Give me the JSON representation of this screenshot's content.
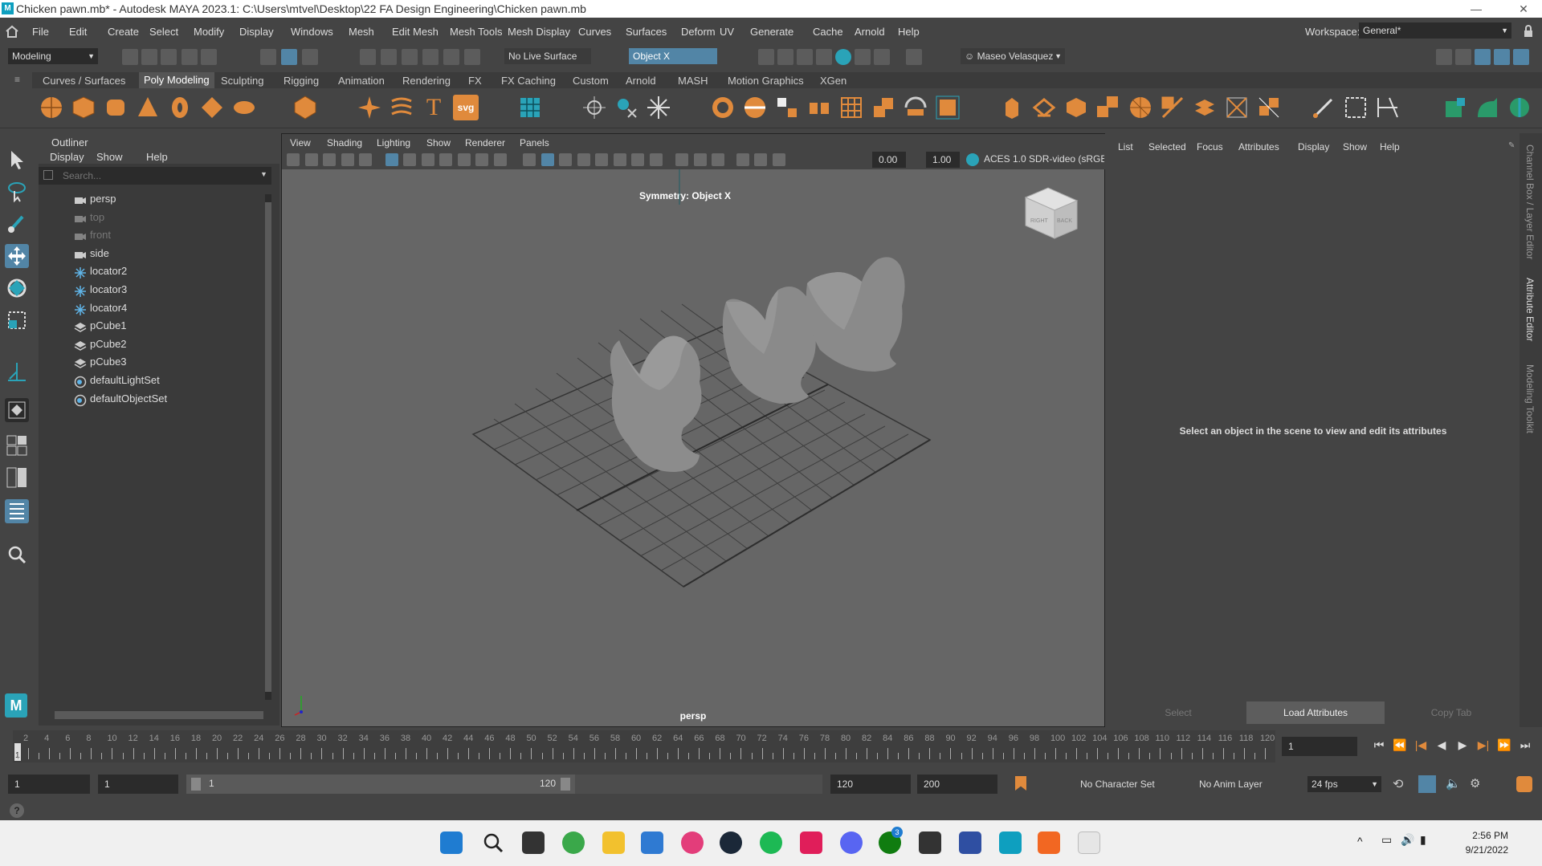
{
  "window": {
    "title": "Chicken pawn.mb* - Autodesk MAYA 2023.1: C:\\Users\\mtvel\\Desktop\\22 FA Design Engineering\\Chicken pawn.mb",
    "min_glyph": "—",
    "max_glyph": "❐",
    "close_glyph": "✕"
  },
  "menubar": {
    "items": [
      "File",
      "Edit",
      "Create",
      "Select",
      "Modify",
      "Display",
      "Windows",
      "Mesh",
      "Edit Mesh",
      "Mesh Tools",
      "Mesh Display",
      "Curves",
      "Surfaces",
      "Deform",
      "UV",
      "Generate",
      "Cache",
      "Arnold",
      "Help"
    ],
    "workspace_label": "Workspace:",
    "workspace_value": "General*"
  },
  "statusline": {
    "mode": "Modeling",
    "live_surface": "No Live Surface",
    "symmetry": "Object X",
    "user": "Maseo Velasquez"
  },
  "shelf": {
    "tabs": [
      "Curves / Surfaces",
      "Poly Modeling",
      "Sculpting",
      "Rigging",
      "Animation",
      "Rendering",
      "FX",
      "FX Caching",
      "Custom",
      "Arnold",
      "MASH",
      "Motion Graphics",
      "XGen"
    ],
    "active_tab": "Poly Modeling",
    "svg_label": "svg",
    "text_label": "T"
  },
  "outliner": {
    "title": "Outliner",
    "menu": [
      "Display",
      "Show",
      "Help"
    ],
    "search_placeholder": "Search...",
    "items": [
      {
        "label": "persp",
        "icon": "camera-icon",
        "dim": false
      },
      {
        "label": "top",
        "icon": "camera-icon",
        "dim": true
      },
      {
        "label": "front",
        "icon": "camera-icon",
        "dim": true
      },
      {
        "label": "side",
        "icon": "camera-icon",
        "dim": false
      },
      {
        "label": "locator2",
        "icon": "locator-icon",
        "dim": false
      },
      {
        "label": "locator3",
        "icon": "locator-icon",
        "dim": false
      },
      {
        "label": "locator4",
        "icon": "locator-icon",
        "dim": false
      },
      {
        "label": "pCube1",
        "icon": "mesh-icon",
        "dim": false
      },
      {
        "label": "pCube2",
        "icon": "mesh-icon",
        "dim": false
      },
      {
        "label": "pCube3",
        "icon": "mesh-icon",
        "dim": false
      },
      {
        "label": "defaultLightSet",
        "icon": "set-icon",
        "dim": false
      },
      {
        "label": "defaultObjectSet",
        "icon": "set-icon",
        "dim": false
      }
    ]
  },
  "viewport": {
    "menu": [
      "View",
      "Shading",
      "Lighting",
      "Show",
      "Renderer",
      "Panels"
    ],
    "symmetry_label": "Symmetry: Object X",
    "camera_label": "persp",
    "field_a": "0.00",
    "field_b": "1.00",
    "color_space": "ACES 1.0 SDR-video (sRGB)",
    "viewcube_right": "RIGHT",
    "viewcube_back": "BACK"
  },
  "attribute_editor": {
    "menu": [
      "List",
      "Selected",
      "Focus",
      "Attributes",
      "Display",
      "Show",
      "Help"
    ],
    "message": "Select an object in the scene to view and edit its attributes",
    "buttons": {
      "select": "Select",
      "load": "Load Attributes",
      "copy": "Copy Tab"
    }
  },
  "sidetabs": [
    "Channel Box / Layer Editor",
    "Attribute Editor",
    "Modeling Toolkit"
  ],
  "timeline": {
    "ticks": [
      "2",
      "4",
      "6",
      "8",
      "10",
      "12",
      "14",
      "16",
      "18",
      "20",
      "22",
      "24",
      "26",
      "28",
      "30",
      "32",
      "34",
      "36",
      "38",
      "40",
      "42",
      "44",
      "46",
      "48",
      "50",
      "52",
      "54",
      "56",
      "58",
      "60",
      "62",
      "64",
      "66",
      "68",
      "70",
      "72",
      "74",
      "76",
      "78",
      "80",
      "82",
      "84",
      "86",
      "88",
      "90",
      "92",
      "94",
      "96",
      "98",
      "100",
      "102",
      "104",
      "106",
      "108",
      "110",
      "112",
      "114",
      "116",
      "118",
      "120"
    ],
    "current_frame": "1",
    "playhead": "1"
  },
  "range": {
    "start": "1",
    "anim_start": "1",
    "slider_start": "1",
    "slider_end": "120",
    "playback_end": "120",
    "anim_end": "200",
    "character_set": "No Character Set",
    "anim_layer": "No Anim Layer",
    "fps": "24 fps"
  },
  "taskbar": {
    "time": "2:56 PM",
    "date": "9/21/2022",
    "badge": "3"
  },
  "colors": {
    "maya_orange": "#e08a3c",
    "maya_teal": "#2aa3b8",
    "selection_blue": "#5285a6"
  }
}
